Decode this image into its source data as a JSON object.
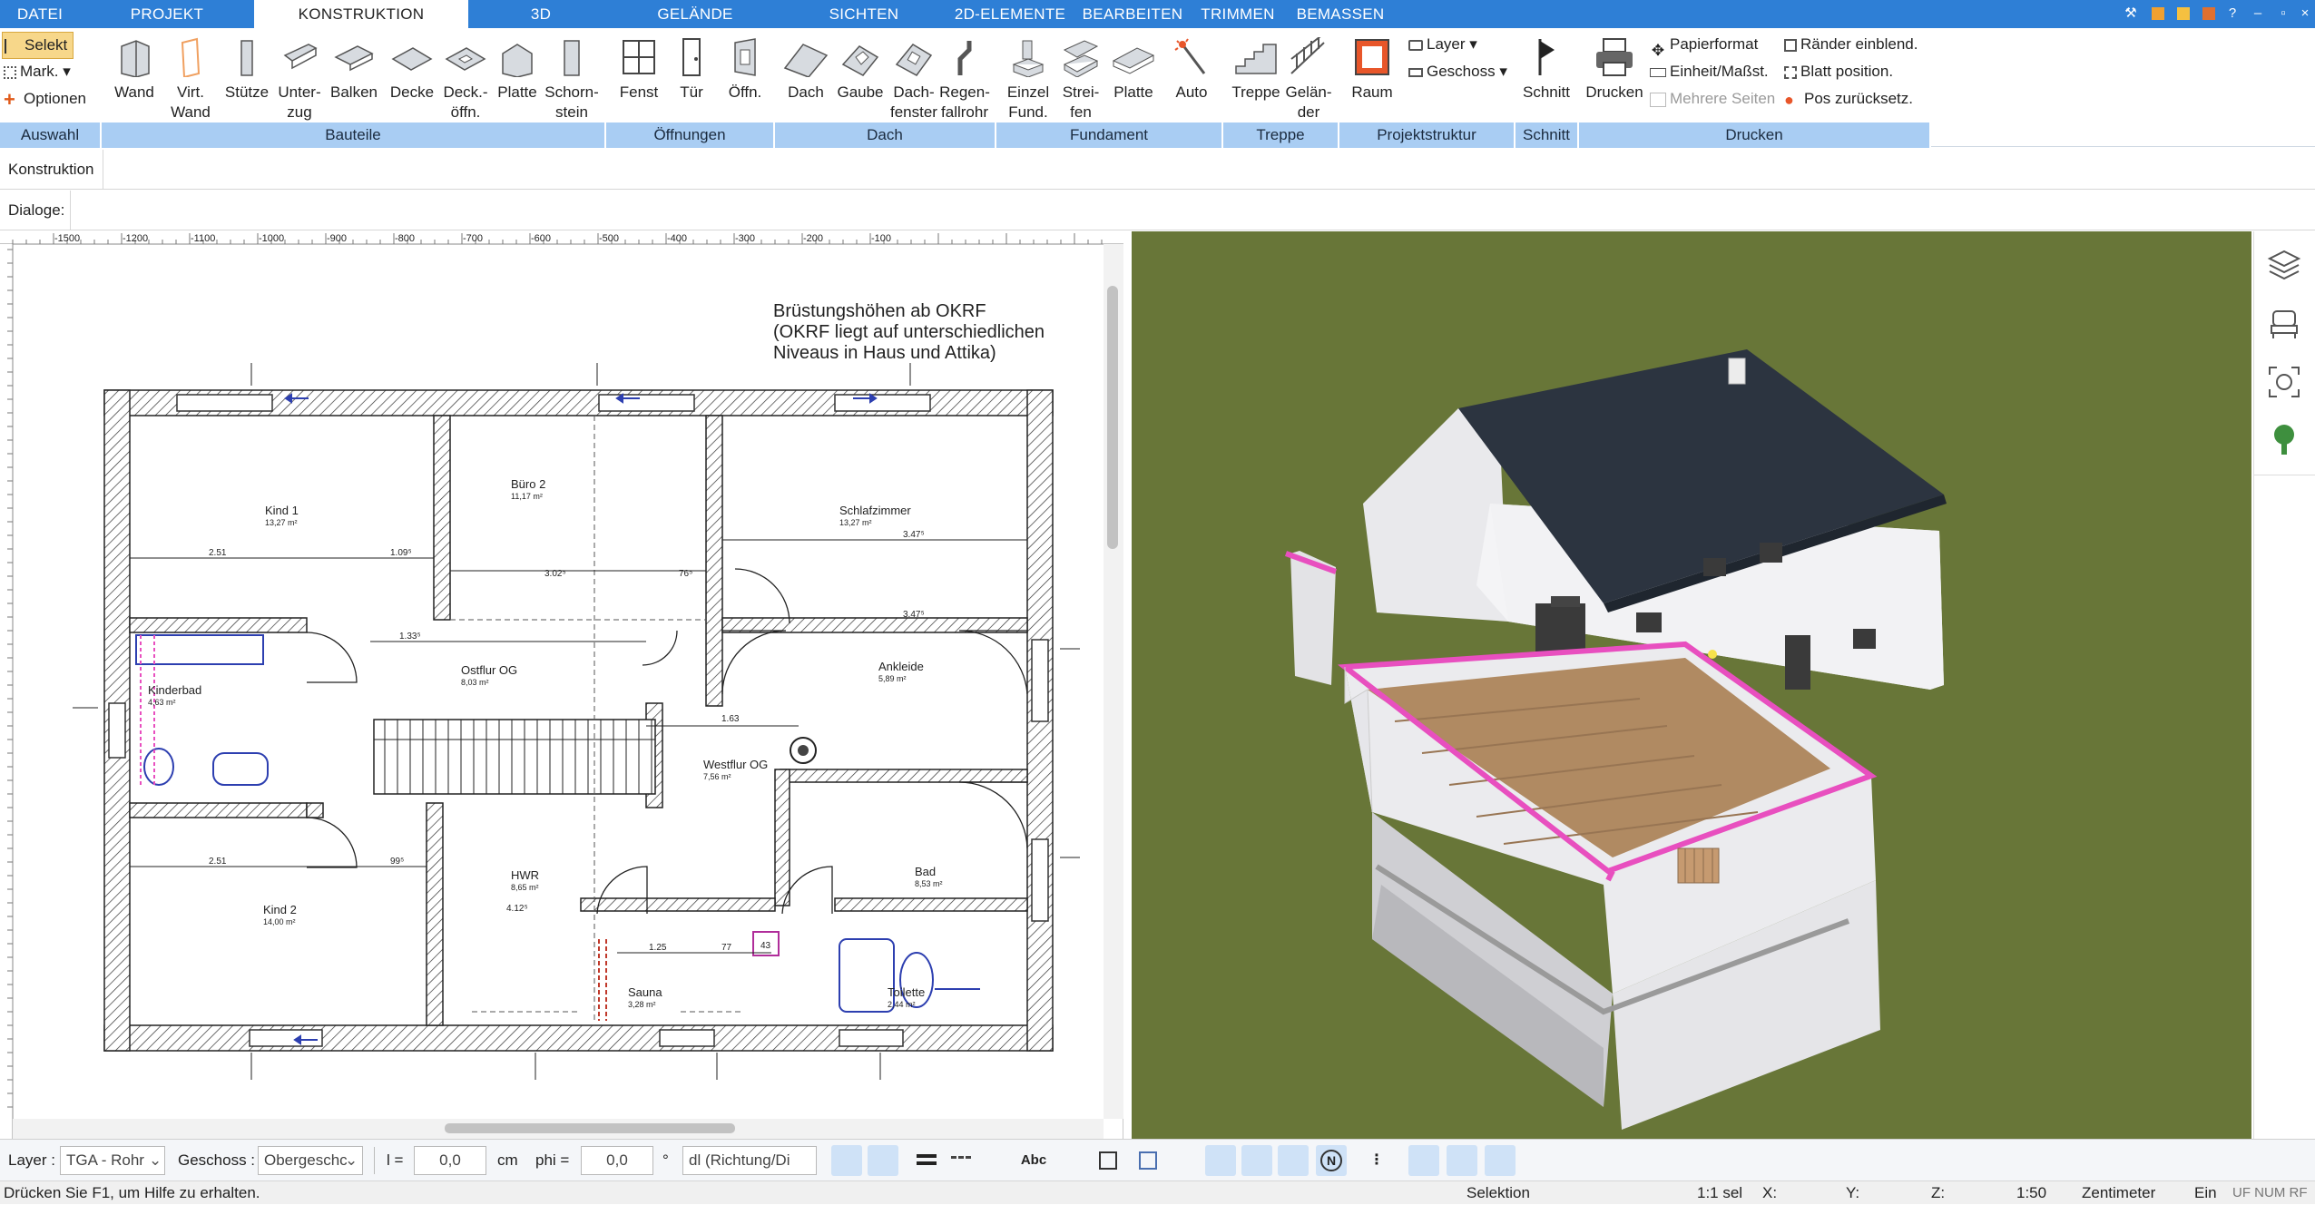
{
  "menu": {
    "tabs": [
      "DATEI",
      "PROJEKT",
      "KONSTRUKTION",
      "3D",
      "GELÄNDE",
      "SICHTEN",
      "2D-ELEMENTE",
      "BEARBEITEN",
      "TRIMMEN",
      "BEMASSEN"
    ],
    "active_tab": "KONSTRUKTION"
  },
  "ribbon": {
    "auswahl": {
      "selekt": "Selekt",
      "mark": "Mark.",
      "optionen": "Optionen",
      "group": "Auswahl"
    },
    "bauteile": {
      "wand": "Wand",
      "virt": "Virt.",
      "virt2": "Wand",
      "stuetze": "Stütze",
      "unterzug": "Unter-",
      "unterzug2": "zug",
      "balken": "Balken",
      "decke": "Decke",
      "deckoeffn": "Deck.-",
      "deckoeffn2": "öffn.",
      "platte": "Platte",
      "schorn": "Schorn-",
      "schorn2": "stein",
      "group": "Bauteile"
    },
    "oeffnungen": {
      "fenst": "Fenst",
      "tuer": "Tür",
      "oeffn": "Öffn.",
      "group": "Öffnungen"
    },
    "dach": {
      "dach": "Dach",
      "gaube": "Gaube",
      "dachfenster": "Dach-",
      "dachfenster2": "fenster",
      "regen": "Regen-",
      "regen2": "fallrohr",
      "group": "Dach"
    },
    "fundament": {
      "einzel": "Einzel",
      "einzel2": "Fund.",
      "streifen": "Strei-",
      "streifen2": "fen",
      "platte": "Platte",
      "auto": "Auto",
      "group": "Fundament"
    },
    "treppe": {
      "treppe": "Treppe",
      "gelaender": "Gelän-",
      "gelaender2": "der",
      "group": "Treppe"
    },
    "projektstruktur": {
      "raum": "Raum",
      "layer": "Layer",
      "geschoss": "Geschoss",
      "group": "Projektstruktur"
    },
    "schnitt": {
      "schnitt": "Schnitt",
      "group": "Schnitt"
    },
    "drucken": {
      "drucken": "Drucken",
      "papierformat": "Papierformat",
      "einheit": "Einheit/Maßst.",
      "mehrere": "Mehrere Seiten",
      "raender": "Ränder einblend.",
      "blatt": "Blatt position.",
      "pos": "Pos zurücksetz.",
      "group": "Drucken"
    }
  },
  "panel": {
    "konstruktion": "Konstruktion",
    "dialoge": "Dialoge:"
  },
  "ruler": {
    "ticks": [
      "-1500",
      "-1200",
      "-1100",
      "-1000",
      "-900",
      "-800",
      "-700",
      "-600",
      "-500",
      "-400",
      "-300",
      "-200",
      "-100"
    ]
  },
  "plan": {
    "note1": "Brüstungshöhen ab OKRF",
    "note2": "(OKRF liegt auf unterschiedlichen",
    "note3": "Niveaus in Haus und Attika)",
    "rooms": [
      {
        "name": "Kind 1",
        "area": "13,27 m²"
      },
      {
        "name": "Büro 2",
        "area": "11,17 m²"
      },
      {
        "name": "Schlafzimmer",
        "area": "13,27 m²"
      },
      {
        "name": "Kinderbad",
        "area": "4,63 m²"
      },
      {
        "name": "Ostflur OG",
        "area": "8,03 m²"
      },
      {
        "name": "Ankleide",
        "area": "5,89 m²"
      },
      {
        "name": "Westflur OG",
        "area": "7,56 m²"
      },
      {
        "name": "Kind 2",
        "area": "14,00 m²"
      },
      {
        "name": "HWR",
        "area": "8,65 m²"
      },
      {
        "name": "Bad",
        "area": "8,53 m²"
      },
      {
        "name": "Sauna",
        "area": "3,28 m²"
      },
      {
        "name": "Toilette",
        "area": "2,44 m²"
      }
    ],
    "dims": {
      "d1": "2.51",
      "d2": "1.09⁵",
      "d3": "3.02⁵",
      "d4": "76⁵",
      "d5": "3.47⁵",
      "d6": "1.63",
      "d7": "2.51",
      "d8": "99⁵",
      "d9": "1.25",
      "d10": "4.12⁵",
      "d11": "1.33⁵",
      "d12": "3.47⁵",
      "d13": "77",
      "d14": "43"
    }
  },
  "bottombar": {
    "layer_label": "Layer :",
    "layer_value": "TGA - Rohr",
    "geschoss_label": "Geschoss :",
    "geschoss_value": "Obergeschc",
    "l_label": "l =",
    "l_value": "0,0",
    "cm": "cm",
    "phi_label": "phi =",
    "phi_value": "0,0",
    "deg": "°",
    "dl_value": "dl (Richtung/Di"
  },
  "status": {
    "help": "Drücken Sie F1, um Hilfe zu erhalten.",
    "mode": "Selektion",
    "scale_sel": "1:1 sel",
    "x": "X:",
    "y": "Y:",
    "z": "Z:",
    "scale": "1:50",
    "unit": "Zentimeter",
    "ein": "Ein",
    "flags": "UF NUM RF"
  },
  "colors": {
    "accent": "#2e7fd6",
    "group_bar": "#a9cdf3",
    "grass": "#6b7a3a",
    "roof": "#2c3440",
    "terrace": "#b08a62",
    "highlight": "#e84fbf"
  }
}
